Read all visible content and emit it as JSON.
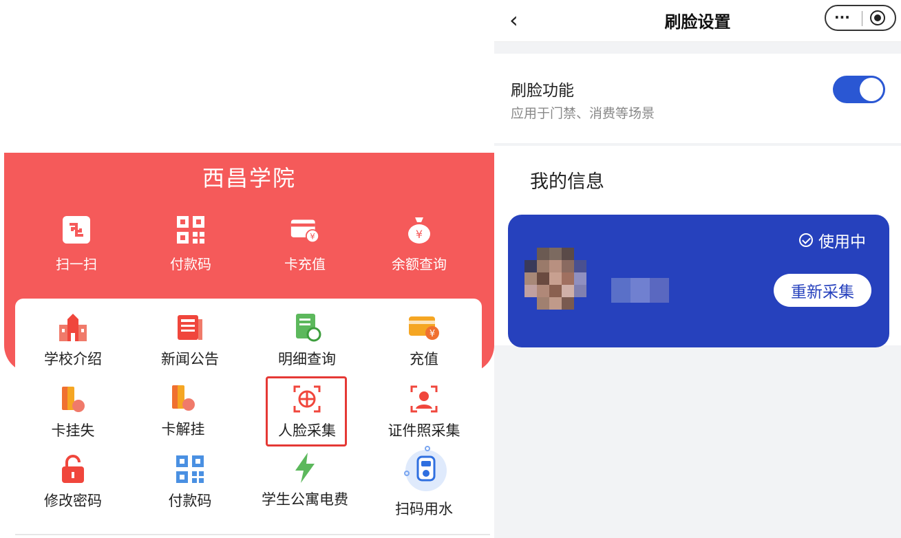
{
  "left": {
    "school_name": "西昌学院",
    "quick_actions": [
      {
        "label": "扫一扫",
        "icon": "scan-icon"
      },
      {
        "label": "付款码",
        "icon": "qr-code-icon"
      },
      {
        "label": "卡充值",
        "icon": "card-recharge-icon"
      },
      {
        "label": "余额查询",
        "icon": "money-bag-icon"
      }
    ],
    "services": [
      {
        "label": "学校介绍",
        "icon": "school-building-icon"
      },
      {
        "label": "新闻公告",
        "icon": "news-icon"
      },
      {
        "label": "明细查询",
        "icon": "detail-query-icon"
      },
      {
        "label": "充值",
        "icon": "recharge-card-icon"
      },
      {
        "label": "卡挂失",
        "icon": "card-report-loss-icon"
      },
      {
        "label": "卡解挂",
        "icon": "card-unlock-icon"
      },
      {
        "label": "人脸采集",
        "icon": "face-capture-icon"
      },
      {
        "label": "证件照采集",
        "icon": "id-photo-capture-icon"
      },
      {
        "label": "修改密码",
        "icon": "lock-icon"
      },
      {
        "label": "付款码",
        "icon": "qr-code-icon"
      },
      {
        "label": "学生公寓电费",
        "icon": "lightning-icon"
      },
      {
        "label": "扫码用水",
        "icon": "water-meter-icon"
      }
    ]
  },
  "right": {
    "nav_title": "刷脸设置",
    "face_function": {
      "title": "刷脸功能",
      "subtitle": "应用于门禁、消费等场景",
      "enabled": true
    },
    "my_info": {
      "title": "我的信息",
      "status": "使用中",
      "recollect_label": "重新采集"
    }
  },
  "colors": {
    "header_red": "#f55a5a",
    "card_blue": "#2641bd",
    "toggle_blue": "#2a57d3",
    "highlight_red": "#e53935"
  }
}
